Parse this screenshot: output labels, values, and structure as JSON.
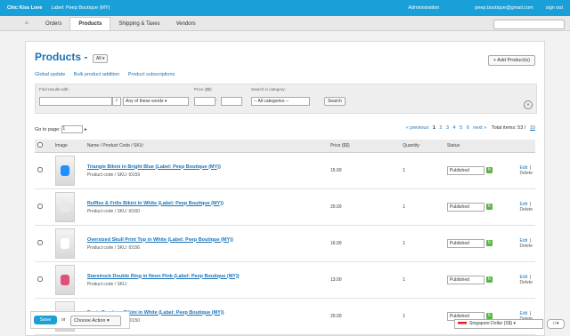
{
  "topbar": {
    "brand": "Chic Kiss Love",
    "label_prefix": "Label: Peep Boutique (MY)",
    "admin": "Administration",
    "email": "peep.boutique@gmail.com",
    "signout": "sign out"
  },
  "nav": {
    "tabs": [
      "Orders",
      "Products",
      "Shipping & Taxes",
      "Vendors"
    ]
  },
  "page": {
    "title": "Products -",
    "all": "All ▾",
    "add": "+ Add Product(s)"
  },
  "links": [
    "Global update",
    "Bulk product addition",
    "Product subscriptions"
  ],
  "filter": {
    "find_label": "Find results with:",
    "any_words": "Any of these words ▾",
    "price_label": "Price ($$):",
    "cat_label": "Search in category:",
    "cat_value": "-- All categories --",
    "search_btn": "Search"
  },
  "pager": {
    "goto": "Go to page:",
    "page_value": "1",
    "prev": "« previous",
    "pages": [
      "1",
      "2",
      "3",
      "4",
      "5",
      "6"
    ],
    "next": "next »",
    "total": "Total items: 53 /",
    "per_page": "10"
  },
  "headers": {
    "image": "Image",
    "name": "Name    /    Product Code / SKU:",
    "price": "Price ($$)",
    "qty": "Quantity",
    "status": "Status"
  },
  "products": [
    {
      "name": "Triangle Bikini in Bright Blue (Label: Peep Boutique (MY))",
      "code": "Product code / SKU:   t0159",
      "price": "15.00",
      "qty": "1",
      "status": "Published",
      "color": "#1e90ff"
    },
    {
      "name": "Ruffles & Frills Bikini in White (Label: Peep Boutique (MY))",
      "code": "Product code / SKU:   t0160",
      "price": "20.00",
      "qty": "1",
      "status": "Published",
      "color": "#e8e8e8"
    },
    {
      "name": "Oversized Skull Print Top in White (Label: Peep Boutique (MY))",
      "code": "Product code / SKU:   t0156",
      "price": "16.00",
      "qty": "1",
      "status": "Published",
      "color": "#ffffff"
    },
    {
      "name": "Starstruck Double Ring in Neon Pink (Label: Peep Boutique (MY))",
      "code": "Product code / SKU:",
      "price": "13.00",
      "qty": "1",
      "status": "Published",
      "color": "#e0507a"
    },
    {
      "name": "Basic Bandeau Bikini in White (Label: Peep Boutique (MY))",
      "code": "Product code / SKU:   t0150",
      "price": "20.00",
      "qty": "1",
      "status": "Published",
      "color": "#f0f0f0"
    }
  ],
  "actions": {
    "edit": "Edit",
    "delete": "Delete"
  },
  "bottom": {
    "save": "Save",
    "or": "or",
    "choose": "Choose Action ▾"
  },
  "currency": "Singapore Dollar (S$)  ▾"
}
